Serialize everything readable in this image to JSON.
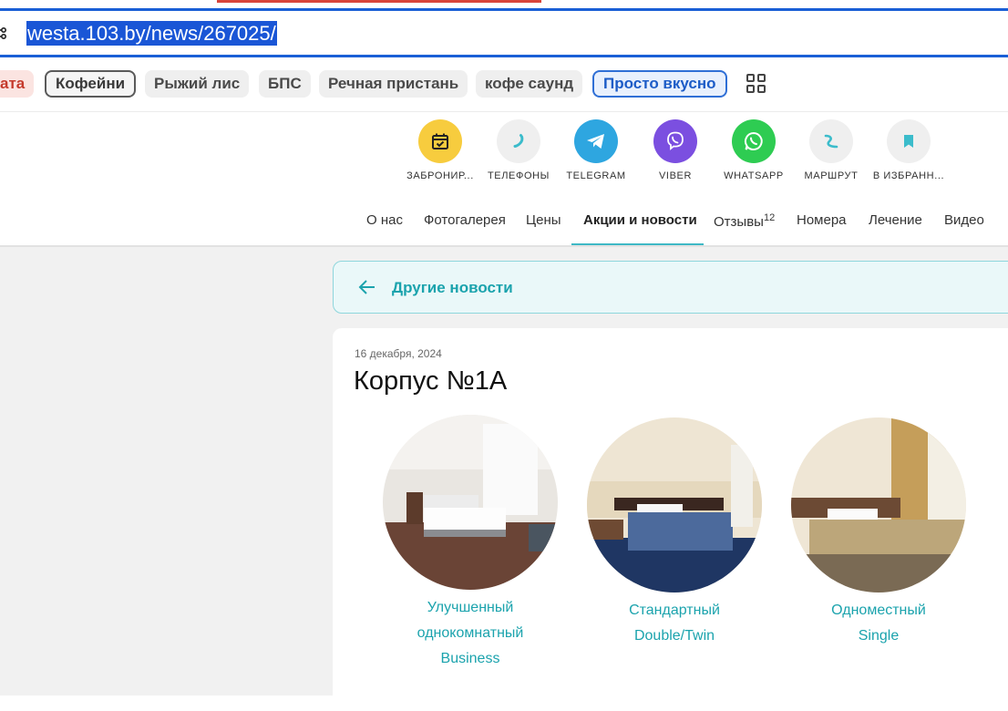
{
  "browser": {
    "url": "westa.103.by/news/267025/"
  },
  "bookmarks": {
    "chips": [
      {
        "label": "ата",
        "style": "red"
      },
      {
        "label": "Кофейни",
        "style": "outlined"
      },
      {
        "label": "Рыжий лис",
        "style": "plain"
      },
      {
        "label": "БПС",
        "style": "plain"
      },
      {
        "label": "Речная пристань",
        "style": "plain"
      },
      {
        "label": "кофе саунд",
        "style": "plain"
      },
      {
        "label": "Просто вкусно",
        "style": "blue"
      }
    ],
    "more_icon": "grid-icon"
  },
  "actions": [
    {
      "label": "ЗАБРОНИР...",
      "icon": "calendar-check-icon",
      "color": "#f7cc3e"
    },
    {
      "label": "ТЕЛЕФОНЫ",
      "icon": "phone-icon",
      "color": "#efefef"
    },
    {
      "label": "TELEGRAM",
      "icon": "telegram-icon",
      "color": "#2ea6e0"
    },
    {
      "label": "VIBER",
      "icon": "viber-icon",
      "color": "#7b4fe0"
    },
    {
      "label": "WHATSAPP",
      "icon": "whatsapp-icon",
      "color": "#2ecc52"
    },
    {
      "label": "МАРШРУТ",
      "icon": "route-icon",
      "color": "#efefef"
    },
    {
      "label": "В ИЗБРАНН...",
      "icon": "bookmark-icon",
      "color": "#efefef"
    }
  ],
  "tabs": {
    "items": [
      {
        "label": "О нас"
      },
      {
        "label": "Фотогалерея"
      },
      {
        "label": "Цены"
      },
      {
        "label": "Акции и новости",
        "active": true
      },
      {
        "label": "Отзывы",
        "count": "12"
      },
      {
        "label": "Номера"
      },
      {
        "label": "Лечение"
      },
      {
        "label": "Видео"
      }
    ]
  },
  "news": {
    "back_label": "Другие новости",
    "date": "16 декабря, 2024",
    "title": "Корпус №1А",
    "rooms": [
      {
        "name_lines": [
          "Улучшенный",
          "однокомнатный",
          "Business"
        ]
      },
      {
        "name_lines": [
          "Стандартный",
          "Double/Twin"
        ]
      },
      {
        "name_lines": [
          "Одноместный",
          "Single"
        ]
      }
    ]
  },
  "colors": {
    "accent_teal": "#1ba3ad",
    "highlight_blue": "#1a56d6"
  }
}
